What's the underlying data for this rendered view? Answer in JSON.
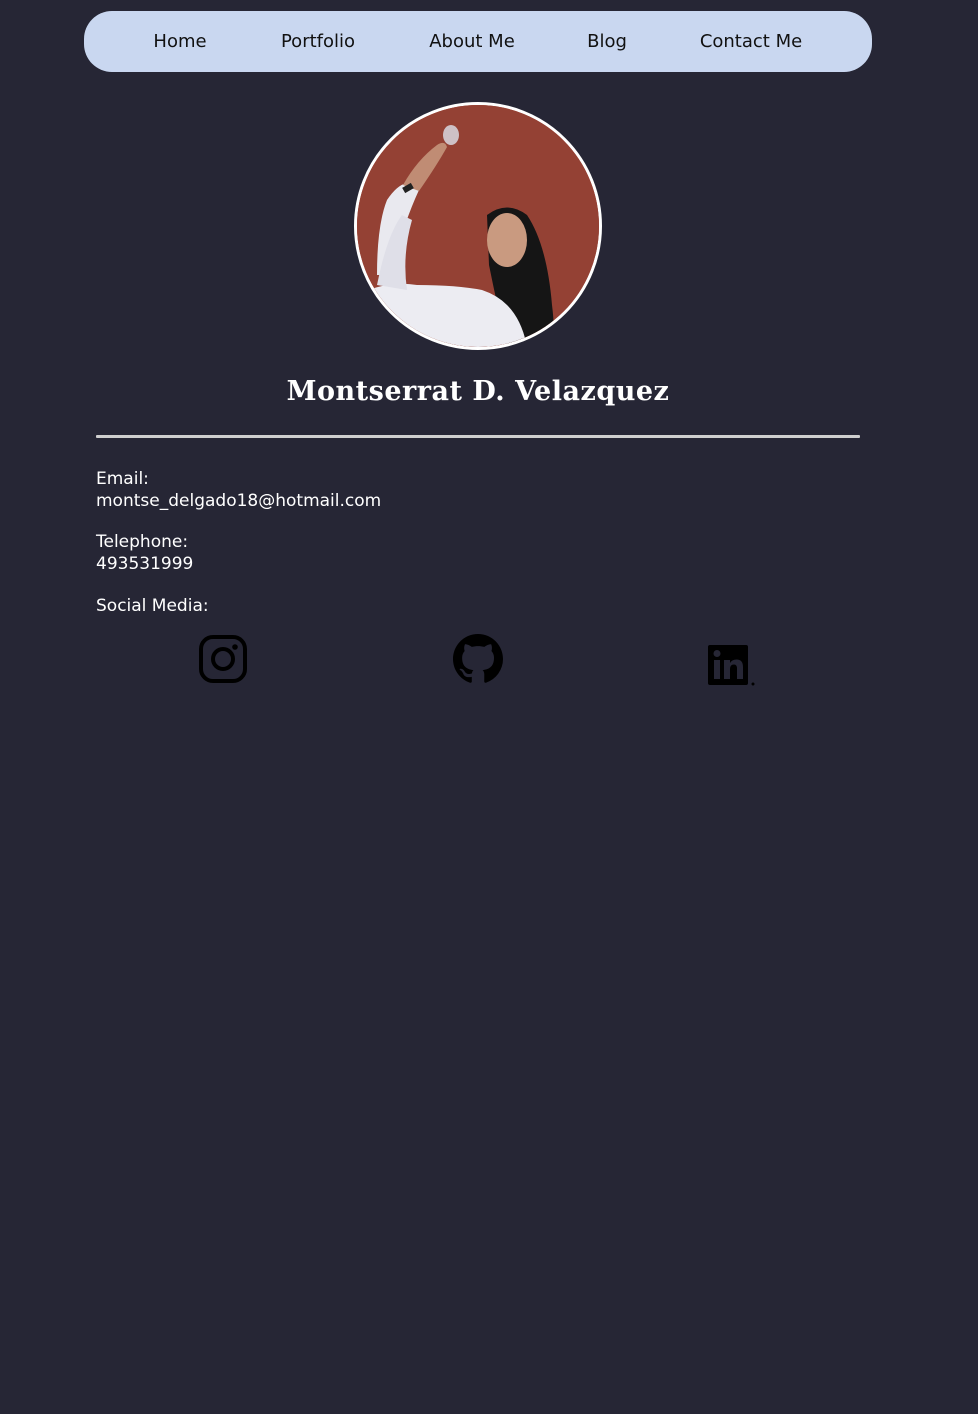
{
  "nav": {
    "home": "Home",
    "portfolio": "Portfolio",
    "about": "About Me",
    "blog": "Blog",
    "contact": "Contact Me"
  },
  "profile": {
    "name": "Montserrat D. Velazquez"
  },
  "contact": {
    "email_label": "Email:",
    "email_value": "montse_delgado18@hotmail.com",
    "telephone_label": "Telephone:",
    "telephone_value": "493531999",
    "social_label": "Social Media:"
  },
  "social": {
    "icons": [
      "instagram-icon",
      "github-icon",
      "linkedin-icon"
    ]
  },
  "colors": {
    "background": "#262635",
    "nav_background": "#c9d7f0",
    "text": "#ffffff",
    "nav_text": "#111111",
    "divider": "#cfcfcf",
    "icon": "#000000"
  }
}
